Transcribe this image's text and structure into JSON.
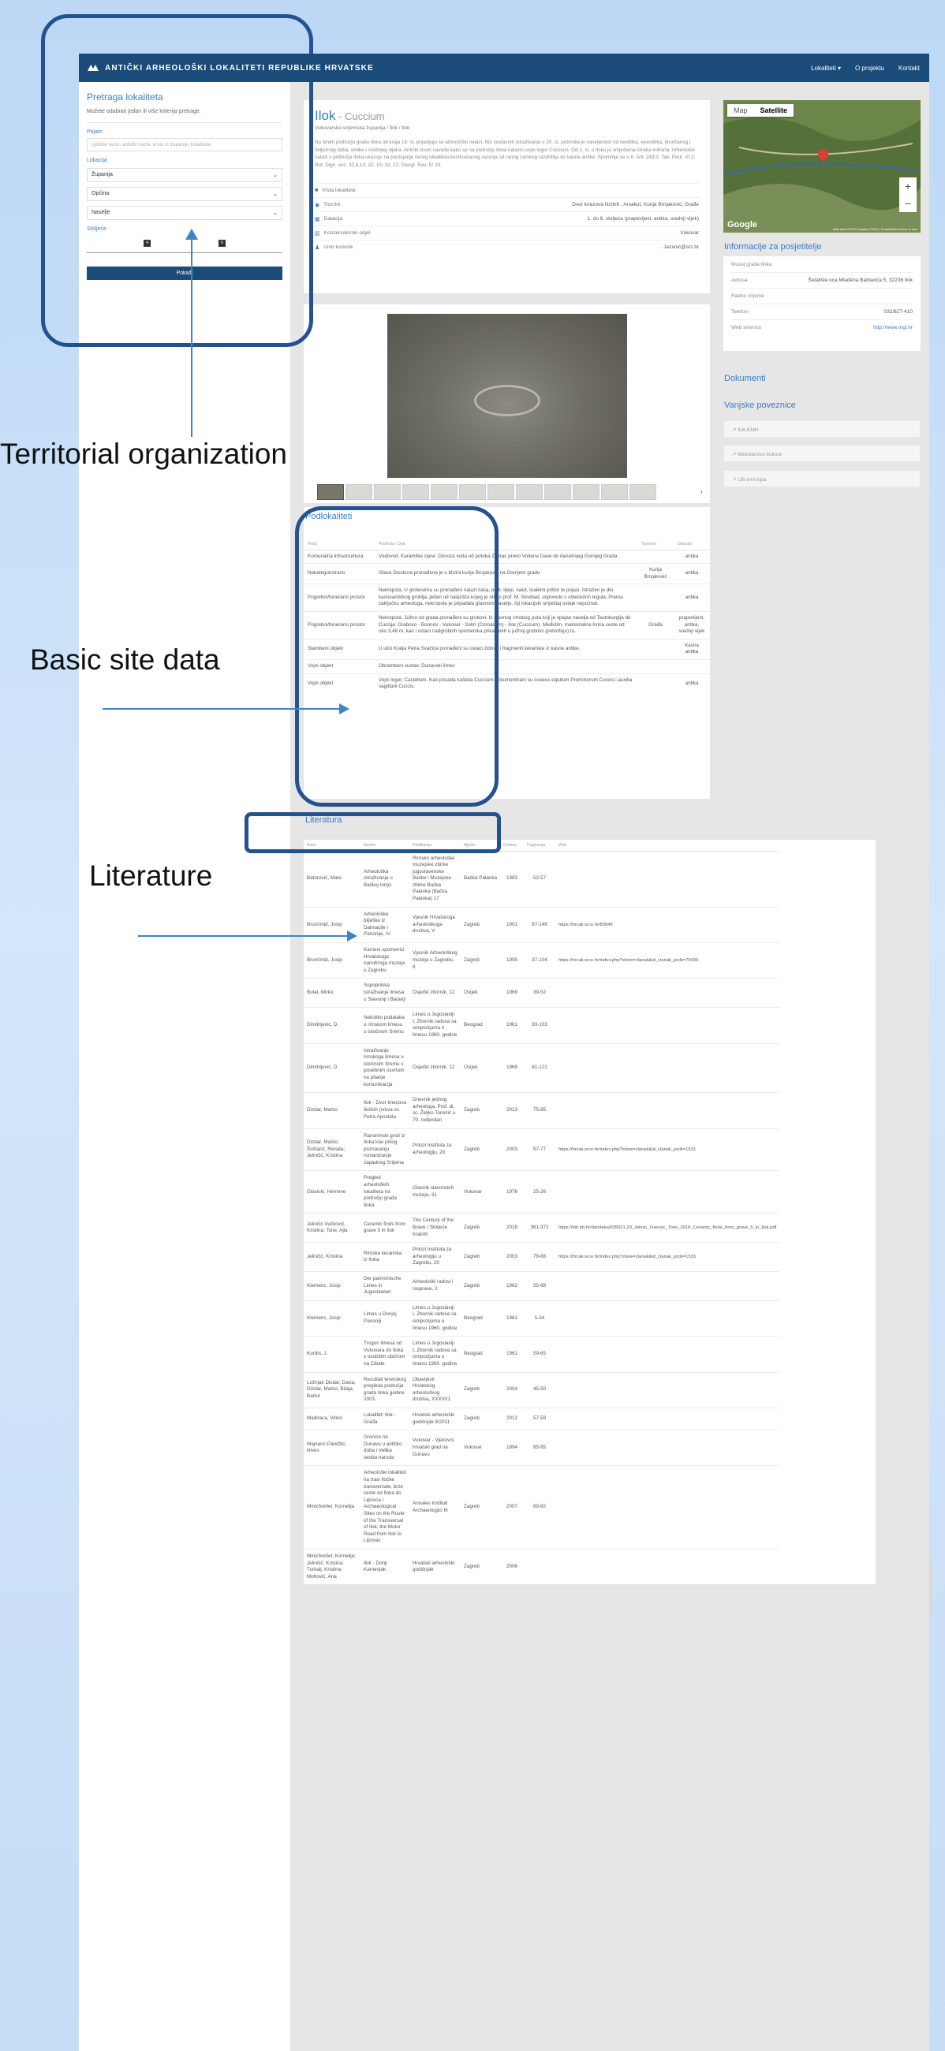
{
  "navbar": {
    "title": "ANTIČKI ARHEOLOŠKI LOKALITETI REPUBLIKE HRVATSKE",
    "links": [
      "Lokaliteti  ▾",
      "O projektu",
      "Kontakt"
    ]
  },
  "sidebar": {
    "heading": "Pretraga lokaliteta",
    "hint": "Možete odabrati jedan ili više kriterija pretrage.",
    "search_label": "Pojam",
    "search_placeholder": "Upišite tezin, antički naziv, vrstu ili županiju lokaliteta",
    "location_label": "Lokacija",
    "select_county": "Županija",
    "select_municipality": "Općina",
    "select_settlement": "Naselje",
    "period_label": "Stoljeće",
    "slider_min": "4",
    "slider_max": "6",
    "search_button": "Pokaži"
  },
  "site": {
    "name": "Ilok",
    "ancient_name": " - Cuccium",
    "breadcrumb": "Vukovarsko-srijemska županija / Ilok / Ilok",
    "description": "Na širem području grada Iloka od kraja 19. st. pojavljuju se arheološki nalazi. Niz sustavnih istraživanja u 20. st. potvrdila je naseljenost od neolitika, eneolitika, brončanog i željeznog doba, antike i srednjeg vijeka. Antički izvori navode kako se na području Iloka nalazio vojni logor Cuccium. Od 1. st. u Iloku je smještena rimska kohorta. Arheološki nalazi s područja Iloka ukazuju na postojanje većeg lokaliteta kontinuiranog razvoja od ranog carskog razdoblja do kasne antike. Spominje se u It. Ant. 243,2; Tab. Peut. VI 2; Not. Dign. occ. 32,6,13; 32, 15; 32, 22; Geogr. Rav. IV 20.",
    "rows": [
      {
        "icon": "■",
        "label": "Vrsta lokaliteta",
        "value": ""
      },
      {
        "icon": "◉",
        "label": "Tlocrtni",
        "value": "Dvor knezova Iločkih , Arsakut, Kurija Brnjaković, Građe"
      },
      {
        "icon": "▦",
        "label": "Datacija",
        "value": "1. do 6. stoljeća (prapovijest, antika, srednji vijek)"
      },
      {
        "icon": "▥",
        "label": "Konzervatorski odjel",
        "value": "Vukovar"
      },
      {
        "icon": "♟",
        "label": "Unio korisnik",
        "value": "Jazanić@srz.hr"
      }
    ]
  },
  "map": {
    "map_label": "Map",
    "satellite_label": "Satellite",
    "zoom_in": "+",
    "zoom_out": "−",
    "logo": "Google",
    "attribution": "Map data ©2019 Imagery ©2019, TerraMetrics  Terms of Use"
  },
  "visitor": {
    "heading": "Informacije za posjetitelje",
    "rows": [
      {
        "label": "Muzej grada Iloka",
        "value": ""
      },
      {
        "label": "Adresa",
        "value": "Šetalište oca Mladena Barbarića 5, 32236 Ilok"
      },
      {
        "label": "Radno vrijeme",
        "value": ""
      },
      {
        "label": "Telefon",
        "value": "032/827-410"
      },
      {
        "label": "Web stranica",
        "value": "http://www.mgi.hr"
      }
    ]
  },
  "documents": {
    "heading": "Dokumenti"
  },
  "external": {
    "heading": "Vanjske poveznice",
    "links": [
      "↗  Ilok.KMH",
      "↗  Ministarstvo kulture",
      "↗  Ulli ernt lupa"
    ]
  },
  "gallery": {
    "thumb_count": 12,
    "active": 0,
    "next": "›"
  },
  "subsites": {
    "heading": "Podlokaliteti",
    "columns": [
      "Vrsta",
      "Podvrsta / Opis",
      "Toponim",
      "Datacija"
    ],
    "rows": [
      {
        "type": "Komunalna infrastruktura",
        "desc": "Vodovod, Karamilke cijevi. Dovoza voda od potoka Zvorac preko Vodene Dave do današnjeg Gornjeg Grada",
        "toponym": "",
        "date": "antika"
      },
      {
        "type": "Nekategorizirano",
        "desc": "Glava Dioskura pronađena je u blizini kurije Brnjaković na Gornjem gradu",
        "toponym": "Kurija Brnjaković",
        "date": "antika"
      },
      {
        "type": "Pogrebni/funerarni prostor",
        "desc": "Nekropola. U grobovima su pronađeni nalazi čaša, perli, lijepi, nakit, toaletni pribor te pojasi. Istražen je dio kasnoantičkog groblja, jedan od nalazišta kojeg je otkrio prof. M. Sinobad, usporedo s oštećenim tegula. Prema zaključku arheologa, nekropola je pripadala glavnom naselju, čiji lokacijski smještaj ostaje nepoznat.",
        "toponym": "",
        "date": "antika"
      },
      {
        "type": "Pogrebni/funerarni prostor",
        "desc": "Nekropola. Južno od grada pronađeni su grobovi. Iz glavnog rimskog puta koji je spajao naselja od Teutoburgija do Cuccija: Grabovo - Bonnov - Vukovar - Sotin (Cornacum) - Ilok (Cuccium). Međutim, maksimalna širina ceste od oko 3,48 m, kao i ostaci nadgrobnih spomenika prikazanih u južnoj grobnici (potvrđuju) to.",
        "toponym": "Građa",
        "date": "prapovijest, antika, srednji vijek"
      },
      {
        "type": "Stambeni objekt",
        "desc": "U ulici Kralja Petra Svačića pronađeni su ostaci zidova i fragmenti keramike iz kasne antike.",
        "toponym": "",
        "date": "Kasna antika"
      },
      {
        "type": "Vojni objekt",
        "desc": "Obrambeni sustav, Dunavski limes",
        "toponym": "",
        "date": ""
      },
      {
        "type": "Vojni objekt",
        "desc": "Vojni logor, Castellum. Kao posada kaštela Cuccium dokumentirani su cuneus equitum Promotorum Cuccis i auxilia sagittarii Cuccis.",
        "toponym": "",
        "date": "antika"
      }
    ]
  },
  "literature": {
    "heading": "Literatura",
    "columns": [
      "Autor",
      "Naslov",
      "Publikacija",
      "Mjesto",
      "Godina",
      "Paginacija",
      "Web"
    ],
    "rows": [
      {
        "author": "Batorović, Mato",
        "title": "Arheološka istraživanja u Bačkoj Ionjci",
        "pub": "Rimsko arheološke muzejske zbirke jugoslavenske Bačke i Muzejske zbirke Bačka Palanka (Bačka Palanka) 17",
        "place": "Bačka Palanka",
        "year": "1983",
        "pages": "52-57",
        "web": ""
      },
      {
        "author": "Brunšmid, Josip",
        "title": "Arheološke bilješke iz Dalmacije i Panonije, IV",
        "pub": "Vjesnik Hrvatskoga arheološkoga društva, V",
        "place": "Zagreb",
        "year": "1901",
        "pages": "87-149",
        "web": "https://hrcak.srce.hr/83040"
      },
      {
        "author": "Brunšmid, Josip",
        "title": "Kameni spomenici Hrvatskoga narodnoga muzeja u Zagrebu",
        "pub": "Vjesnik Arheološkog muzeja u Zagrebu, 8",
        "place": "Zagreb",
        "year": "1905",
        "pages": "37-104",
        "web": "https://hrcak.srce.hr/index.php?show=clanak&id_clanak_jezik=79439"
      },
      {
        "author": "Bulat, Mirko",
        "title": "Supopolska istraživanja limesa u Slavoniji i Baranji",
        "pub": "Osječki zbornik, 12",
        "place": "Osijek",
        "year": "1969",
        "pages": "39-52",
        "web": ""
      },
      {
        "author": "Dimitrijević, D.",
        "title": "Nekoliko podataka o rimskom limesu u istočnom Sremu",
        "pub": "Limes u Jugoslaviji I, Zbornik radova sa simpozijuma o limesu 1960. godine",
        "place": "Beograd",
        "year": "1961",
        "pages": "93-103",
        "web": ""
      },
      {
        "author": "Dimitrijević, D.",
        "title": "Istraživanje rimskoga limesa u istočnom Sremu s posebnim osvrtom na pitanje komunikacija",
        "pub": "Osječki zbornik, 12",
        "place": "Osijek",
        "year": "1969",
        "pages": "81-121",
        "web": ""
      },
      {
        "author": "Dizdar, Marko",
        "title": "Ilok - Dvor knezova Iločkih (crkva sv. Petra Apostola",
        "pub": "Dnevnik jednog arheologa. Prof. dr. sc. Željko Tomičić u 70. rođendan",
        "place": "Zagreb",
        "year": "2013",
        "pages": "75-85",
        "web": ""
      },
      {
        "author": "Dizdar, Marko; Šoštarić, Renata; Jelinčić, Kristina",
        "title": "Ranorimski grob iz Iloka kao prilog poznavanju romanizacije zapadnog Srijema",
        "pub": "Prilozi Instituta za arheologiju, 20",
        "place": "Zagreb",
        "year": "2003",
        "pages": "57-77",
        "web": "https://hrcak.srce.hr/index.php?show=clanak&id_clanak_jezik=1531"
      },
      {
        "author": "Glavicki, Hermine",
        "title": "Pregled arheoloških lokaliteta na području grada Iloka",
        "pub": "Glasnik slavonskih muzeja, 31",
        "place": "Vukovar",
        "year": "1976",
        "pages": "25-26",
        "web": ""
      },
      {
        "author": "Jelinčić Vučković, Kristina; Tone, Ajla",
        "title": "Ceramic finds from grave 5 in Ilok",
        "pub": "The Century of the Brave / Stoljeće hrabrih",
        "place": "Zagreb",
        "year": "2018",
        "pages": "361-372",
        "web": "https://bib.irb.hr/datoteka/935021.29_Jelinic_Vukovic_Tone_2018_Ceramic_finds_from_grave_5_in_Ilok.pdf"
      },
      {
        "author": "Jelinčić, Kristina",
        "title": "Rimska keramika iz Iloka",
        "pub": "Prilozi Instituta za arheologiju u Zagrebu, 20",
        "place": "Zagreb",
        "year": "2003",
        "pages": "79-88",
        "web": "https://hrcak.srce.hr/index.php?show=clanak&id_clanak_jezik=1533"
      },
      {
        "author": "Klemenc, Josip",
        "title": "Der pannonische Limes in Jugoslawien",
        "pub": "Arheološki radovi i rasprave, 2",
        "place": "Zagreb",
        "year": "1962",
        "pages": "55-68",
        "web": ""
      },
      {
        "author": "Klemenc, Josip",
        "title": "Limes u Donjoj Panoniji",
        "pub": "Limes u Jugoslaviji I, Zbornik radova sa simpozijuma o limesu 1960. godine",
        "place": "Beograd",
        "year": "1961",
        "pages": "5-34",
        "web": ""
      },
      {
        "author": "Kordis, J.",
        "title": "Trogon limesa od Vukovara do Iloka s osobitim obzirom na Cibale",
        "pub": "Limes u Jugoslaviji I, Zbornik radova sa simpozijuma o limesu 1960. godine",
        "place": "Beograd",
        "year": "1961",
        "pages": "59-65",
        "web": ""
      },
      {
        "author": "Ložnjak Dizdar, Daria; Dizdar, Marko; Bilaja, Bartul",
        "title": "Rezultati terenskog pregleda područja grada Iloka godine 2003.",
        "pub": "Obavijesti Hrvatskog arheološkog društva, XXXVI/1",
        "place": "Zagreb",
        "year": "2004",
        "pages": "45-50",
        "web": ""
      },
      {
        "author": "Madiraca, Vinko",
        "title": "Lokalitet: Ilok - Građa",
        "pub": "Hrvatski arheološki godišnjak 8/2011",
        "place": "Zagreb",
        "year": "2012",
        "pages": "57-59",
        "web": ""
      },
      {
        "author": "Majnarić-Pandžić, Nives",
        "title": "Granice na Dunavu u antičko doba i Velika seoba naroda",
        "pub": "Vukovar - Vjekovni hrvatski grad na Dunavu",
        "place": "Vukovar",
        "year": "1994",
        "pages": "85-95",
        "web": ""
      },
      {
        "author": "Minichreiter, Kornelija",
        "title": "Arheološki lokaliteti na trasi Iločke transverzale, brze ceste od Iloka do Lipovca / Archaeological Sites on the Route of the Transversal of Ilok, the Motor Road from Ilok to Lipovac",
        "pub": "Annales Instituti Archaeologici III",
        "place": "Zagreb",
        "year": "2007",
        "pages": "89-92",
        "web": ""
      },
      {
        "author": "Minichreiter, Kornelija; Jelinčić, Kristina; Turkalj, Kristina; Mohović, Ana",
        "title": "Ilok - Donji Kamenjak",
        "pub": "Hrvatski arheološki godišnjak",
        "place": "Zagreb",
        "year": "2006",
        "pages": "",
        "web": ""
      }
    ]
  },
  "annotations": {
    "label_territorial": "Territorial organization",
    "label_basic": "Basic site data",
    "label_literature": "Literature"
  },
  "colors": {
    "navbar": "#1b4b79",
    "accent": "#3a7cc8",
    "annotation_box": "#24528f",
    "arrow": "#3f84c9"
  }
}
